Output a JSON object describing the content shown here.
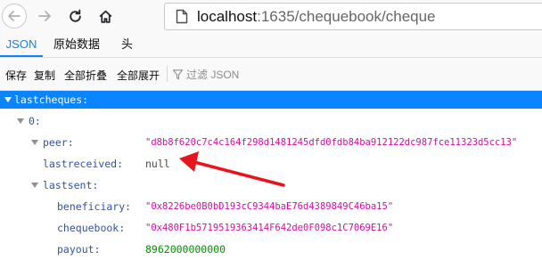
{
  "browser": {
    "url_host": "localhost",
    "url_rest": ":1635/chequebook/cheque"
  },
  "tabs": [
    {
      "label": "JSON",
      "active": true
    },
    {
      "label": "原始数据",
      "active": false
    },
    {
      "label": "头",
      "active": false
    }
  ],
  "toolbar": {
    "save": "保存",
    "copy": "复制",
    "collapse_all": "全部折叠",
    "expand_all": "全部展开",
    "filter_placeholder": "过滤 JSON"
  },
  "tree": {
    "root_key": "lastcheques:",
    "index_key": "0:",
    "peer_key": "peer:",
    "peer_value": "\"d8b8f620c7c4c164f298d1481245dfd0fdb84ba912122dc987fce11323d5cc13\"",
    "lastreceived_key": "lastreceived:",
    "lastreceived_value": "null",
    "lastsent_key": "lastsent:",
    "beneficiary_key": "beneficiary:",
    "beneficiary_value": "\"0x8226be0B0bD193cC9344baE76d4389849C46ba15\"",
    "chequebook_key": "chequebook:",
    "chequebook_value": "\"0x480F1b5719519363414F642de0F098c1C7069E16\"",
    "payout_key": "payout:",
    "payout_value": "8962000000000"
  },
  "colors": {
    "accent": "#0a84ff",
    "string": "#d30ea3",
    "number": "#058b00",
    "key": "#34539e",
    "annotation_arrow": "#e8141b"
  },
  "icons": [
    "back-arrow-icon",
    "forward-arrow-icon",
    "reload-icon",
    "home-icon",
    "page-icon",
    "filter-icon",
    "annotation-arrow-icon"
  ]
}
